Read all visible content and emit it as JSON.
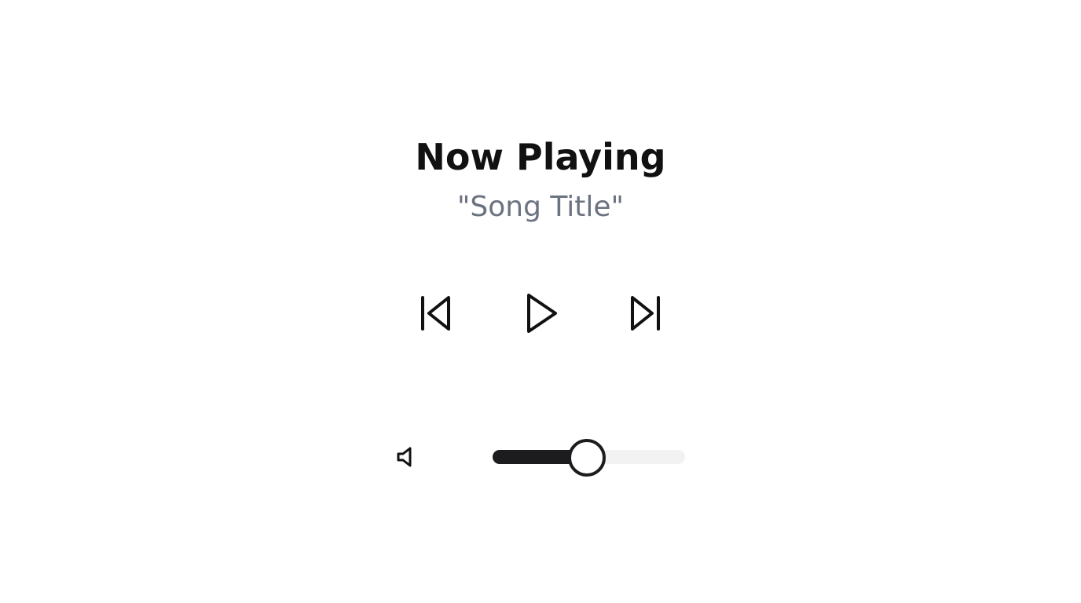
{
  "header": {
    "title": "Now Playing",
    "song_title": "\"Song Title\""
  },
  "controls": {
    "previous_icon": "skip-back-icon",
    "play_icon": "play-icon",
    "next_icon": "skip-forward-icon"
  },
  "volume": {
    "icon": "speaker-icon",
    "level": 0.49
  },
  "colors": {
    "title": "#111111",
    "subtitle": "#6b7280",
    "accent": "#1c1c1e",
    "track": "#f2f2f2"
  }
}
